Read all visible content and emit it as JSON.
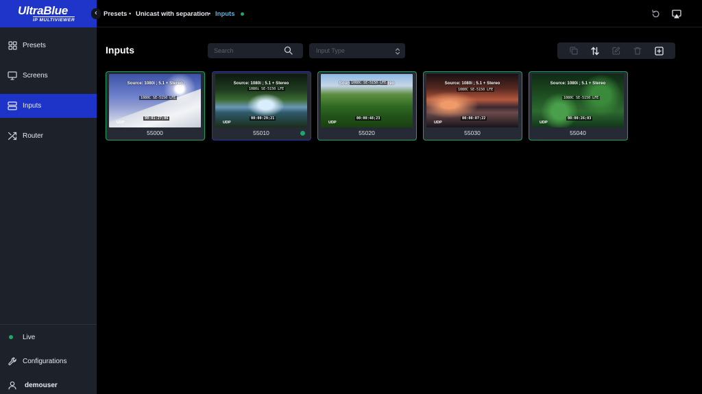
{
  "brand": {
    "name": "UltraBlue",
    "tagline": "IP MULTIVIEWER"
  },
  "sidebar": {
    "collapse_icon": "‹",
    "items": [
      {
        "label": "Presets",
        "icon": "grid-icon",
        "active": false
      },
      {
        "label": "Screens",
        "icon": "monitor-icon",
        "active": false
      },
      {
        "label": "Inputs",
        "icon": "server-icon",
        "active": true
      },
      {
        "label": "Router",
        "icon": "shuffle-icon",
        "active": false
      }
    ],
    "bottom": {
      "live": "Live",
      "configurations": "Configurations",
      "user": "demouser"
    }
  },
  "breadcrumb": {
    "items": [
      "Presets",
      "Unicast with separation",
      "Inputs"
    ],
    "separator": "•",
    "status_color": "#1fa66b"
  },
  "main": {
    "title": "Inputs",
    "search": {
      "placeholder": "Search",
      "value": ""
    },
    "input_type": {
      "placeholder": "Input Type"
    },
    "actions": [
      "copy-icon",
      "sort-icon",
      "edit-icon",
      "trash-icon",
      "add-icon"
    ]
  },
  "inputs": [
    {
      "label": "55000",
      "source": "Source: 1080i ; 5.1 + Stereo",
      "lfe": "1080C SE-5150 LFE",
      "timecode": "00:01:27;06",
      "protocol": "UDP",
      "selected": false,
      "status_dot": false
    },
    {
      "label": "55010",
      "source": "Source: 1080i ; 5.1 + Stereo",
      "lfe": "1080i SE-5150 LFE",
      "timecode": "00:00:29;21",
      "protocol": "UDP",
      "selected": true,
      "status_dot": true
    },
    {
      "label": "55020",
      "source": "Source: 1080i ; 5.1 + Stereo",
      "lfe": "1080C SE-5150 LFE",
      "timecode": "00:00:48;23",
      "protocol": "UDP",
      "selected": false,
      "status_dot": false
    },
    {
      "label": "55030",
      "source": "Source: 1080i ; 5.1 + Stereo",
      "lfe": "1080C SE-5150 LFE",
      "timecode": "00:00:07;22",
      "protocol": "UDP",
      "selected": false,
      "status_dot": false
    },
    {
      "label": "55040",
      "source": "Source: 1080i ; 5.1 + Stereo",
      "lfe": "1080C SE-5150 LFE",
      "timecode": "00:00:26;03",
      "protocol": "UDP",
      "selected": false,
      "status_dot": false
    }
  ],
  "colors": {
    "accent": "#1e34c8",
    "online": "#1aa35c",
    "selected_border": "#2138b8",
    "breadcrumb_current": "#57b3e8"
  }
}
